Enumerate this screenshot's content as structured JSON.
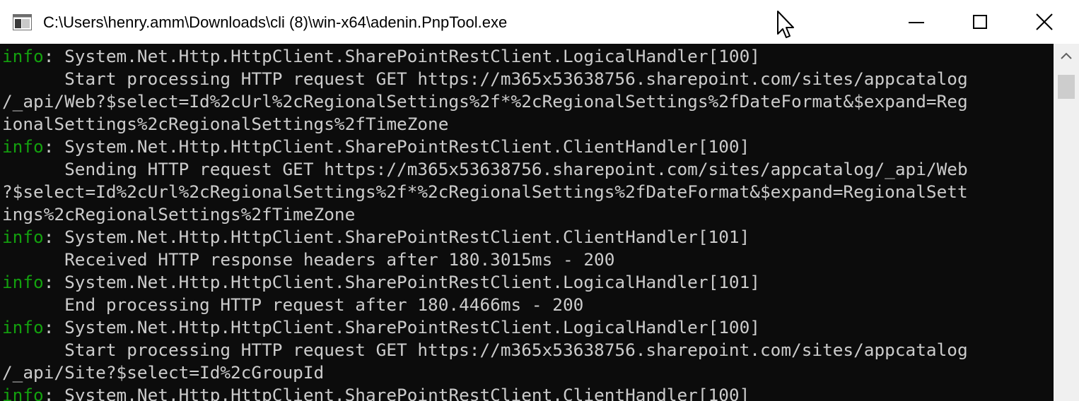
{
  "window": {
    "title": "C:\\Users\\henry.amm\\Downloads\\cli (8)\\win-x64\\adenin.PnpTool.exe"
  },
  "console": {
    "lines": [
      {
        "level": "info",
        "text": ": System.Net.Http.HttpClient.SharePointRestClient.LogicalHandler[100]"
      },
      {
        "level": "",
        "text": "      Start processing HTTP request GET https://m365x53638756.sharepoint.com/sites/appcatalog"
      },
      {
        "level": "",
        "text": "/_api/Web?$select=Id%2cUrl%2cRegionalSettings%2f*%2cRegionalSettings%2fDateFormat&$expand=Reg"
      },
      {
        "level": "",
        "text": "ionalSettings%2cRegionalSettings%2fTimeZone"
      },
      {
        "level": "info",
        "text": ": System.Net.Http.HttpClient.SharePointRestClient.ClientHandler[100]"
      },
      {
        "level": "",
        "text": "      Sending HTTP request GET https://m365x53638756.sharepoint.com/sites/appcatalog/_api/Web"
      },
      {
        "level": "",
        "text": "?$select=Id%2cUrl%2cRegionalSettings%2f*%2cRegionalSettings%2fDateFormat&$expand=RegionalSett"
      },
      {
        "level": "",
        "text": "ings%2cRegionalSettings%2fTimeZone"
      },
      {
        "level": "info",
        "text": ": System.Net.Http.HttpClient.SharePointRestClient.ClientHandler[101]"
      },
      {
        "level": "",
        "text": "      Received HTTP response headers after 180.3015ms - 200"
      },
      {
        "level": "info",
        "text": ": System.Net.Http.HttpClient.SharePointRestClient.LogicalHandler[101]"
      },
      {
        "level": "",
        "text": "      End processing HTTP request after 180.4466ms - 200"
      },
      {
        "level": "info",
        "text": ": System.Net.Http.HttpClient.SharePointRestClient.LogicalHandler[100]"
      },
      {
        "level": "",
        "text": "      Start processing HTTP request GET https://m365x53638756.sharepoint.com/sites/appcatalog"
      },
      {
        "level": "",
        "text": "/_api/Site?$select=Id%2cGroupId"
      },
      {
        "level": "info",
        "text": ": System.Net.Http.HttpClient.SharePointRestClient.ClientHandler[100]"
      }
    ]
  },
  "colors": {
    "console_background": "#0c0c0c",
    "console_text": "#cccccc",
    "info_level": "#13a10e",
    "scrollbar_track": "#f0f0f0",
    "scrollbar_thumb": "#cdcdcd"
  },
  "icons": {
    "app": "console-app-icon",
    "minimize": "minimize-icon",
    "maximize": "maximize-icon",
    "close": "close-icon",
    "cursor": "mouse-pointer-icon",
    "scroll_up": "scroll-up-arrow-icon"
  }
}
